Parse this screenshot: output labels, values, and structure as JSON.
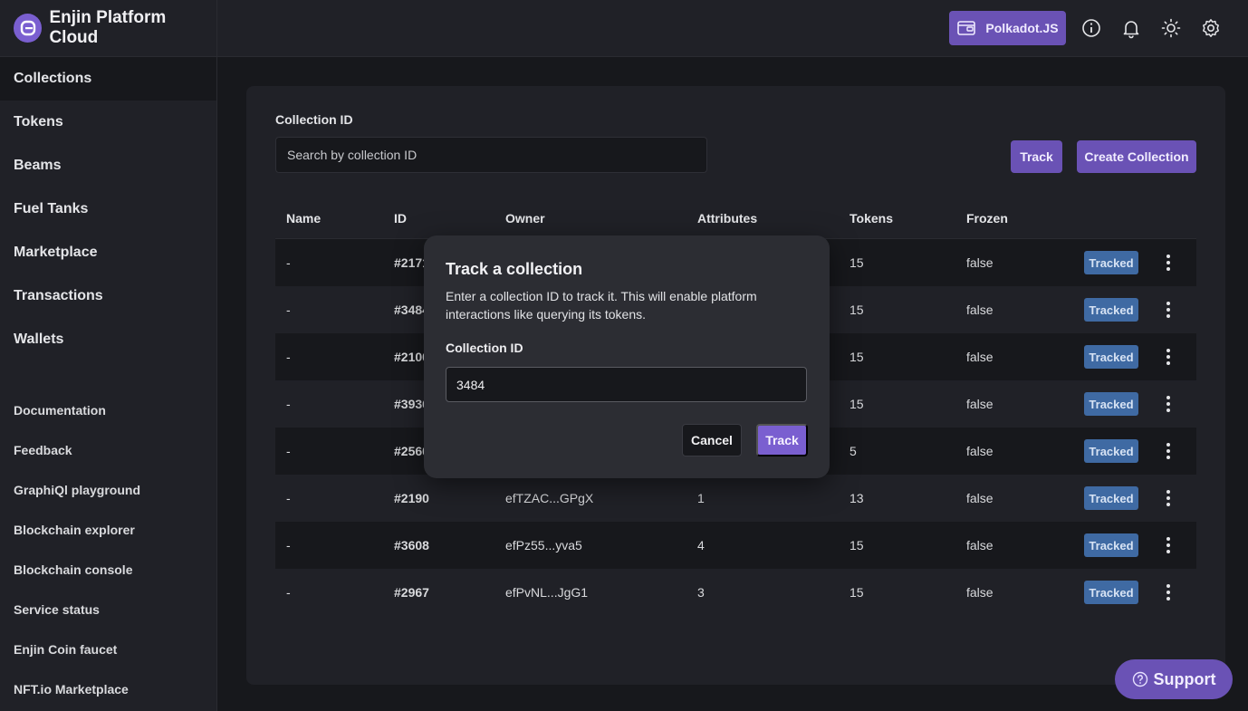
{
  "brand": {
    "title": "Enjin Platform Cloud"
  },
  "sidebar": {
    "nav": [
      {
        "label": "Collections",
        "active": true
      },
      {
        "label": "Tokens"
      },
      {
        "label": "Beams"
      },
      {
        "label": "Fuel Tanks"
      },
      {
        "label": "Marketplace"
      },
      {
        "label": "Transactions"
      },
      {
        "label": "Wallets"
      }
    ],
    "links": [
      {
        "label": "Documentation"
      },
      {
        "label": "Feedback"
      },
      {
        "label": "GraphiQl playground"
      },
      {
        "label": "Blockchain explorer"
      },
      {
        "label": "Blockchain console"
      },
      {
        "label": "Service status"
      },
      {
        "label": "Enjin Coin faucet"
      },
      {
        "label": "NFT.io Marketplace"
      }
    ]
  },
  "header": {
    "wallet_label": "Polkadot.JS",
    "icons": [
      "info-icon",
      "bell-icon",
      "sun-icon",
      "gear-icon"
    ]
  },
  "filter": {
    "label": "Collection ID",
    "placeholder": "Search by collection ID",
    "track_label": "Track",
    "create_label": "Create Collection"
  },
  "table": {
    "columns": [
      "Name",
      "ID",
      "Owner",
      "Attributes",
      "Tokens",
      "Frozen"
    ],
    "rows": [
      {
        "name": "-",
        "id": "#2171",
        "owner": "",
        "attributes": "",
        "tokens": "15",
        "frozen": "false",
        "status": "Tracked"
      },
      {
        "name": "-",
        "id": "#3484",
        "owner": "",
        "attributes": "",
        "tokens": "15",
        "frozen": "false",
        "status": "Tracked"
      },
      {
        "name": "-",
        "id": "#2100",
        "owner": "",
        "attributes": "",
        "tokens": "15",
        "frozen": "false",
        "status": "Tracked"
      },
      {
        "name": "-",
        "id": "#3936",
        "owner": "",
        "attributes": "",
        "tokens": "15",
        "frozen": "false",
        "status": "Tracked"
      },
      {
        "name": "-",
        "id": "#2560",
        "owner": "",
        "attributes": "",
        "tokens": "5",
        "frozen": "false",
        "status": "Tracked"
      },
      {
        "name": "-",
        "id": "#2190",
        "owner": "efTZAC...GPgX",
        "attributes": "1",
        "tokens": "13",
        "frozen": "false",
        "status": "Tracked"
      },
      {
        "name": "-",
        "id": "#3608",
        "owner": "efPz55...yva5",
        "attributes": "4",
        "tokens": "15",
        "frozen": "false",
        "status": "Tracked"
      },
      {
        "name": "-",
        "id": "#2967",
        "owner": "efPvNL...JgG1",
        "attributes": "3",
        "tokens": "15",
        "frozen": "false",
        "status": "Tracked"
      }
    ]
  },
  "modal": {
    "title": "Track a collection",
    "description": "Enter a collection ID to track it. This will enable platform interactions like querying its tokens.",
    "field_label": "Collection ID",
    "field_value": "3484",
    "cancel_label": "Cancel",
    "track_label": "Track"
  },
  "support": {
    "label": "Support"
  },
  "colors": {
    "accent": "#6a52b5",
    "badge": "#3f6aa3",
    "background": "#17181c",
    "panel": "#202127"
  }
}
